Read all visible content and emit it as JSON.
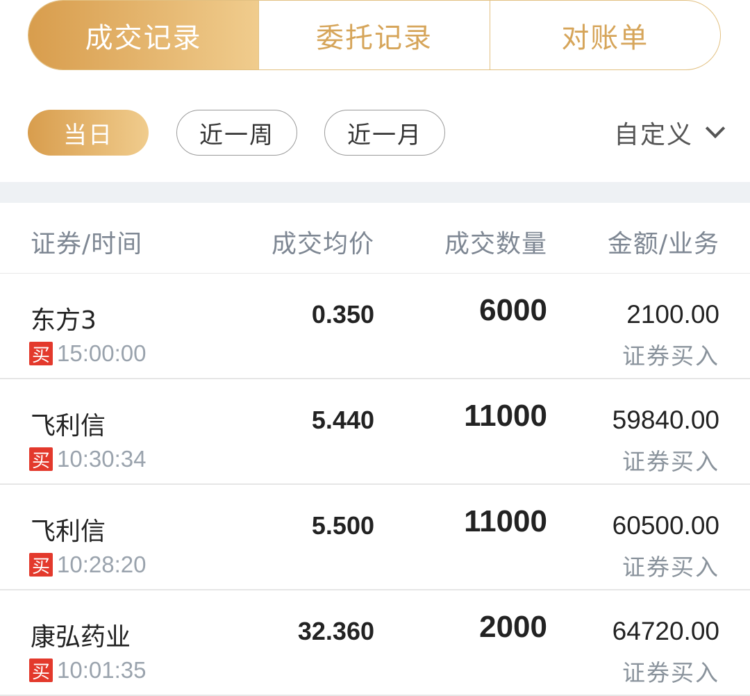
{
  "tabs": [
    {
      "label": "成交记录",
      "active": true
    },
    {
      "label": "委托记录",
      "active": false
    },
    {
      "label": "对账单",
      "active": false
    }
  ],
  "periods": [
    {
      "label": "当日",
      "active": true
    },
    {
      "label": "近一周",
      "active": false
    },
    {
      "label": "近一月",
      "active": false
    }
  ],
  "custom": {
    "label": "自定义",
    "icon": "chevron-down-icon"
  },
  "table": {
    "headers": [
      "证券/时间",
      "成交均价",
      "成交数量",
      "金额/业务"
    ],
    "rows": [
      {
        "name": "东方3",
        "side": "买",
        "time": "15:00:00",
        "price": "0.350",
        "qty": "6000",
        "amount": "2100.00",
        "biz": "证券买入"
      },
      {
        "name": "飞利信",
        "side": "买",
        "time": "10:30:34",
        "price": "5.440",
        "qty": "11000",
        "amount": "59840.00",
        "biz": "证券买入"
      },
      {
        "name": "飞利信",
        "side": "买",
        "time": "10:28:20",
        "price": "5.500",
        "qty": "11000",
        "amount": "60500.00",
        "biz": "证券买入"
      },
      {
        "name": "康弘药业",
        "side": "买",
        "time": "10:01:35",
        "price": "32.360",
        "qty": "2000",
        "amount": "64720.00",
        "biz": "证券买入"
      }
    ]
  },
  "colors": {
    "accent_gold": "#d89d4d",
    "accent_gold_light": "#f0cc8d",
    "buy_red": "#e3392c"
  }
}
